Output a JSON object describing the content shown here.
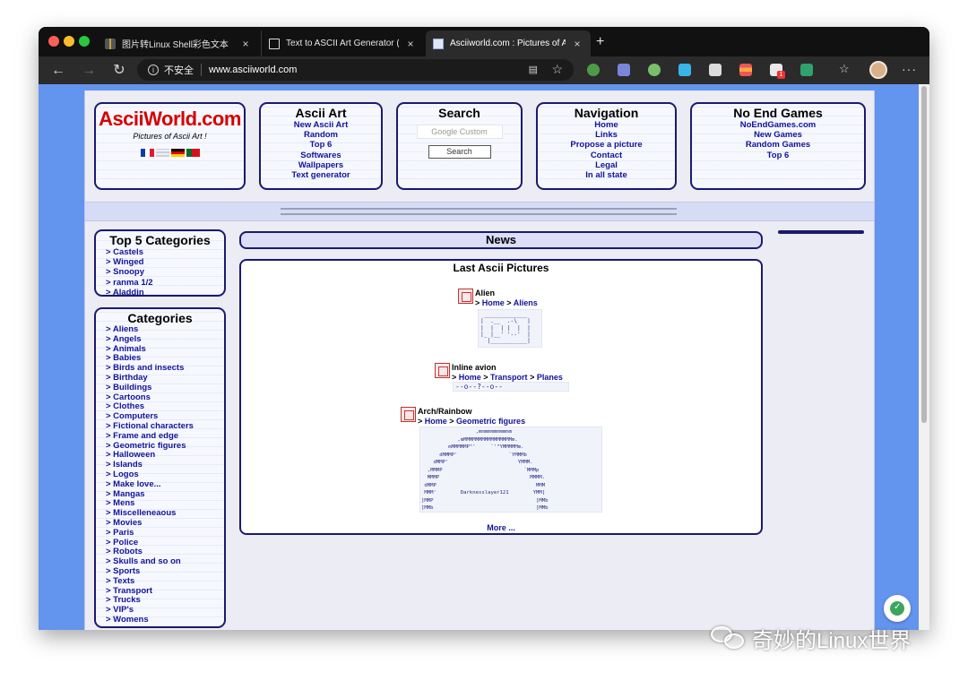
{
  "browser": {
    "tabs": [
      {
        "title": "图片转Linux Shell彩色文本",
        "close": "×"
      },
      {
        "title": "Text to ASCII Art Generator (TAAG)",
        "close": "×"
      },
      {
        "title": "Asciiworld.com : Pictures of Ascii Art",
        "close": "×"
      }
    ],
    "new_tab": "+",
    "back": "←",
    "forward": "→",
    "reload": "↻",
    "security_label": "不安全",
    "url": "www.asciiworld.com",
    "more": "···",
    "badge_count": "1"
  },
  "header": {
    "logo": {
      "title": "AsciiWorld.com",
      "subtitle": "Pictures of Ascii Art !"
    },
    "ascii_art": {
      "title": "Ascii Art",
      "links": [
        "New Ascii Art",
        "Random",
        "Top 6",
        "Softwares",
        "Wallpapers",
        "Text generator"
      ]
    },
    "search": {
      "title": "Search",
      "placeholder": "Google Custom",
      "button": "Search"
    },
    "navigation": {
      "title": "Navigation",
      "links": [
        "Home",
        "Links",
        "Propose a picture",
        "Contact",
        "Legal",
        "In all state"
      ]
    },
    "games": {
      "title": "No End Games",
      "links": [
        "NoEndGames.com",
        "New Games",
        "Random Games",
        "Top 6"
      ]
    }
  },
  "sidebar": {
    "top5": {
      "title": "Top 5 Categories",
      "items": [
        "> Castels",
        "> Winged",
        "> Snoopy",
        "> ranma 1/2",
        "> Aladdin"
      ]
    },
    "categories": {
      "title": "Categories",
      "items": [
        "> Aliens",
        "> Angels",
        "> Animals",
        "> Babies",
        "> Birds and insects",
        "> Birthday",
        "> Buildings",
        "> Cartoons",
        "> Clothes",
        "> Computers",
        "> Fictional characters",
        "> Frame and edge",
        "> Geometric figures",
        "> Halloween",
        "> Islands",
        "> Logos",
        "> Make love...",
        "> Mangas",
        "> Mens",
        "> Miscelleneaous",
        "> Movies",
        "> Paris",
        "> Police",
        "> Robots",
        "> Skulls and so on",
        "> Sports",
        "> Texts",
        "> Transport",
        "> Trucks",
        "> VIP's",
        "> Womens"
      ]
    }
  },
  "main": {
    "news_title": "News",
    "pictures_title": "Last Ascii Pictures",
    "items": [
      {
        "name": "Alien",
        "sep": "> ",
        "crumbs": [
          "Home",
          "Aliens"
        ],
        "art": " _____________\n|  .__  .-\\   |\n|  |  | |  |  |\n|_ |__' '--'  |\n  |___________|"
      },
      {
        "name": "Inline avion",
        "sep": "> ",
        "crumbs": [
          "Home",
          "Transport",
          "Planes"
        ],
        "art": "--o--?--o--"
      },
      {
        "name": "Arch/Rainbow",
        "sep": "> ",
        "crumbs": [
          "Home",
          "Geometric figures"
        ],
        "art": "                  ,mmmmmmmmmmm\n            ,mMMMMMMMMMMMMMMMMm.\n         mMMMMMP\"'     `'\"YMMMMMm.\n      dMMMP'                 `YMMMb\n    dMMP'                       YMMM.\n  ,MMMP                           `MMMp\n  MMMP                              MMMM.\n dMMP                                 MMM\n MMM'        Darknesslayer121        YMM[\n]MMP                                  ]MMb\n]MMb                                  ]MMb"
      }
    ],
    "more": "More ..."
  },
  "watermark": "奇妙的Linux世界"
}
